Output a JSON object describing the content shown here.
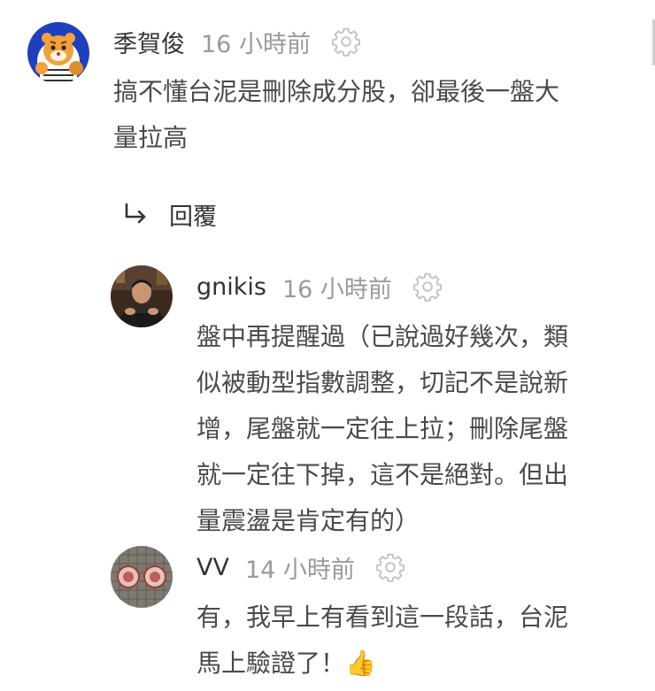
{
  "comments": [
    {
      "author": "季賀俊",
      "time": "16 小時前",
      "text": "搞不懂台泥是刪除成分股，卻最後一盤大\n量拉高",
      "avatar": "tiger-avatar"
    },
    {
      "author": "gnikis",
      "time": "16 小時前",
      "text": "盤中再提醒過（已說過好幾次，類\n似被動型指數調整，切記不是說新\n增，尾盤就一定往上拉；刪除尾盤\n就一定往下掉，這不是絕對。但出\n量震盪是肯定有的）",
      "avatar": "person-avatar"
    },
    {
      "author": "VV",
      "time": "14 小時前",
      "text": "有，我早上有看到這一段話，台泥\n馬上驗證了！",
      "emoji": "👍",
      "avatar": "pattern-avatar"
    }
  ],
  "reply": {
    "label": "回覆",
    "icon": "reply-arrow-icon"
  },
  "icons": {
    "gear": "gear-icon"
  },
  "colors": {
    "text": "#4a4a4a",
    "author": "#333333",
    "muted": "#9a9a9a",
    "background": "#ffffff",
    "thumbs": "#f4b400"
  }
}
